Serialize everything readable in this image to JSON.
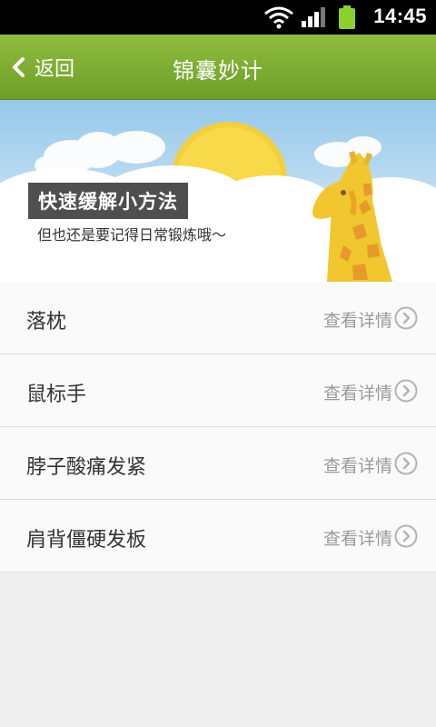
{
  "status_bar": {
    "time": "14:45"
  },
  "header": {
    "back_label": "返回",
    "title": "锦囊妙计"
  },
  "banner": {
    "heading": "快速缓解小方法",
    "subtitle": "但也还是要记得日常锻炼哦～"
  },
  "list": {
    "items": [
      {
        "label": "落枕",
        "action": "查看详情"
      },
      {
        "label": "鼠标手",
        "action": "查看详情"
      },
      {
        "label": "脖子酸痛发紧",
        "action": "查看详情"
      },
      {
        "label": "肩背僵硬发板",
        "action": "查看详情"
      }
    ]
  },
  "colors": {
    "accent": "#7aab2e",
    "status_bar": "#000000",
    "battery": "#8bd12e"
  }
}
